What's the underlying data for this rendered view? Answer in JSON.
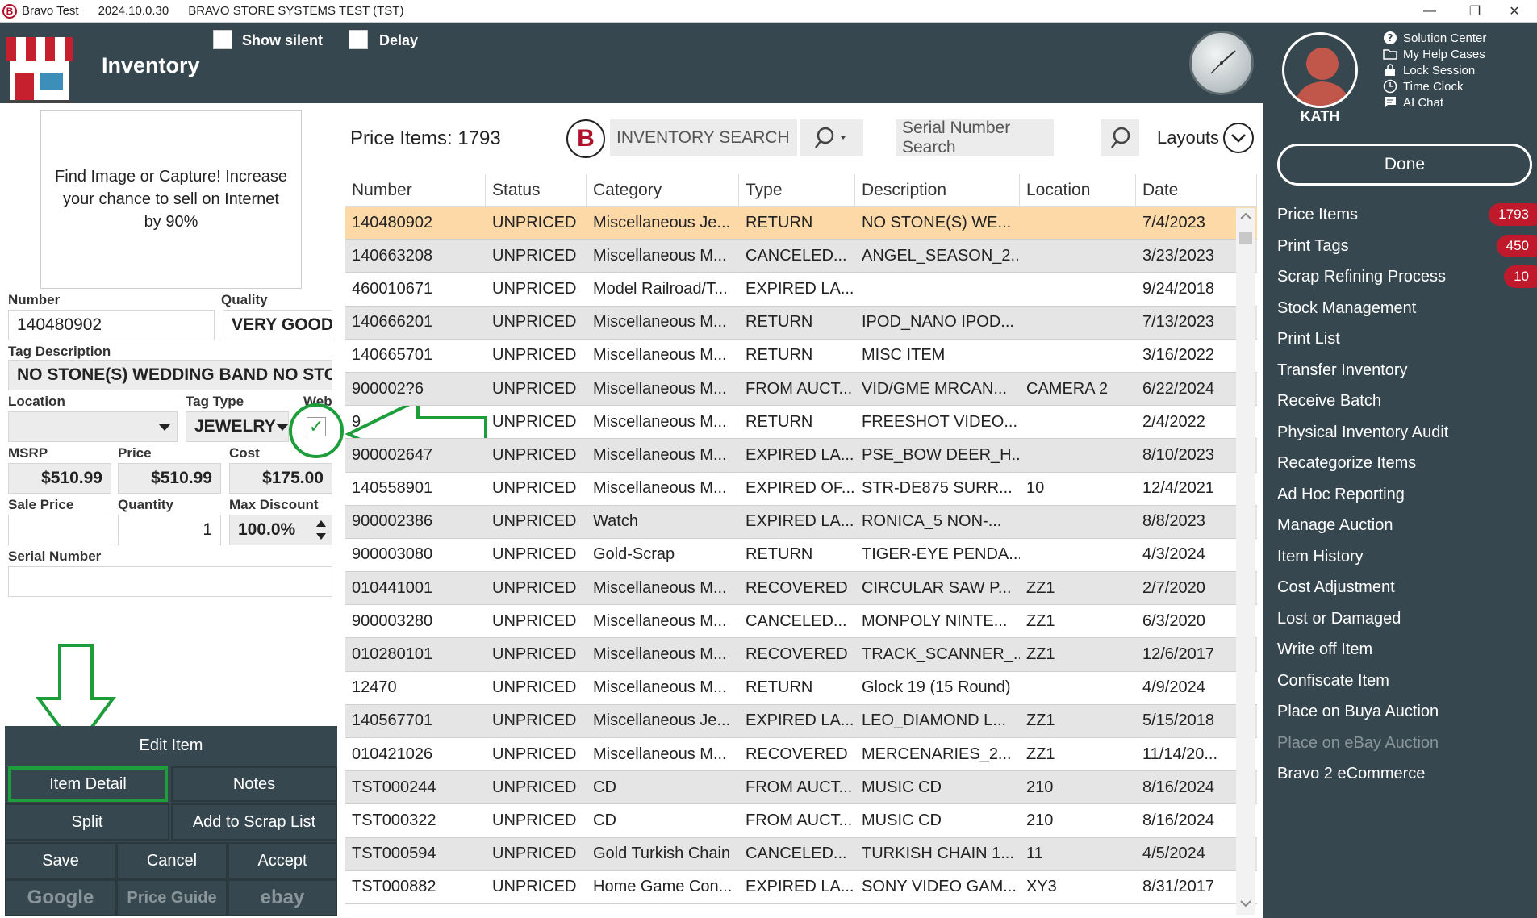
{
  "titlebar": {
    "app": "Bravo Test",
    "version": "2024.10.0.30",
    "system": "BRAVO STORE SYSTEMS TEST (TST)",
    "minimize": "—",
    "maximize": "❐",
    "close": "✕"
  },
  "header": {
    "title": "Inventory",
    "show_silent": "Show silent",
    "delay": "Delay"
  },
  "user": {
    "name": "KATH",
    "links": [
      "Solution Center",
      "My Help Cases",
      "Lock Session",
      "Time Clock",
      "AI Chat"
    ]
  },
  "done_label": "Done",
  "menu": [
    {
      "label": "Price Items",
      "badge": "1793"
    },
    {
      "label": "Print Tags",
      "badge": "450"
    },
    {
      "label": "Scrap Refining Process",
      "badge": "10"
    },
    {
      "label": "Stock Management"
    },
    {
      "label": "Print List"
    },
    {
      "label": "Transfer Inventory"
    },
    {
      "label": "Receive Batch"
    },
    {
      "label": "Physical Inventory Audit"
    },
    {
      "label": "Recategorize Items"
    },
    {
      "label": "Ad Hoc Reporting"
    },
    {
      "label": "Manage Auction"
    },
    {
      "label": "Item History"
    },
    {
      "label": "Cost Adjustment"
    },
    {
      "label": "Lost or Damaged"
    },
    {
      "label": "Write off Item"
    },
    {
      "label": "Confiscate Item"
    },
    {
      "label": "Place on Buya Auction"
    },
    {
      "label": "Place on eBay Auction",
      "disabled": true
    },
    {
      "label": "Bravo 2 eCommerce"
    }
  ],
  "image_box": "Find Image or Capture! Increase your chance to sell on Internet by 90%",
  "form": {
    "number_label": "Number",
    "number": "140480902",
    "quality_label": "Quality",
    "quality": "VERY GOOD",
    "tagdesc_label": "Tag Description",
    "tagdesc": "NO STONE(S)  WEDDING BAND NO STO",
    "location_label": "Location",
    "location": "",
    "tagtype_label": "Tag Type",
    "tagtype": "JEWELRY",
    "web_label": "Web",
    "web_check": "✓",
    "msrp_label": "MSRP",
    "msrp": "$510.99",
    "price_label": "Price",
    "price": "$510.99",
    "cost_label": "Cost",
    "cost": "$175.00",
    "saleprice_label": "Sale Price",
    "saleprice": "",
    "quantity_label": "Quantity",
    "quantity": "1",
    "maxdisc_label": "Max Discount",
    "maxdisc": "100.0%",
    "serial_label": "Serial Number",
    "serial": ""
  },
  "buttons": {
    "edit_item": "Edit Item",
    "item_detail": "Item Detail",
    "notes": "Notes",
    "split": "Split",
    "add_scrap": "Add to Scrap List",
    "save": "Save",
    "cancel": "Cancel",
    "accept": "Accept",
    "google": "Google",
    "price_guide": "Price Guide",
    "ebay": "ebay"
  },
  "main": {
    "count_label": "Price Items:  1793",
    "inventory_search_placeholder": "INVENTORY SEARCH",
    "serial_search_placeholder": "Serial Number Search",
    "layouts": "Layouts"
  },
  "table": {
    "headers": [
      "Number",
      "Status",
      "Category",
      "Type",
      "Description",
      "Location",
      "Date"
    ],
    "rows": [
      [
        "140480902",
        "UNPRICED",
        "Miscellaneous Je...",
        "RETURN",
        "NO STONE(S)  WE...",
        "",
        "7/4/2023"
      ],
      [
        "140663208",
        "UNPRICED",
        "Miscellaneous M...",
        "CANCELED...",
        "ANGEL_SEASON_2...",
        "",
        "3/23/2023"
      ],
      [
        "460010671",
        "UNPRICED",
        "Model Railroad/T...",
        "EXPIRED LA...",
        "",
        "",
        "9/24/2018"
      ],
      [
        "140666201",
        "UNPRICED",
        "Miscellaneous M...",
        "RETURN",
        "IPOD_NANO  IPOD...",
        "",
        "7/13/2023"
      ],
      [
        "140665701",
        "UNPRICED",
        "Miscellaneous M...",
        "RETURN",
        "MISC ITEM",
        "",
        "3/16/2022"
      ],
      [
        "900002?6",
        "UNPRICED",
        "Miscellaneous M...",
        "FROM AUCT...",
        "VID/GME MRCAN...",
        "CAMERA 2",
        "6/22/2024"
      ],
      [
        "9",
        "UNPRICED",
        "Miscellaneous M...",
        "RETURN",
        " FREESHOT VIDEO...",
        "",
        "2/4/2022"
      ],
      [
        "900002647",
        "UNPRICED",
        "Miscellaneous M...",
        "EXPIRED LA...",
        "PSE_BOW DEER_H...",
        "",
        "8/10/2023"
      ],
      [
        "140558901",
        "UNPRICED",
        "Miscellaneous M...",
        "EXPIRED OF...",
        " STR-DE875 SURR...",
        "10",
        "12/4/2021"
      ],
      [
        "900002386",
        "UNPRICED",
        "Watch",
        "EXPIRED LA...",
        "RONICA_5  NON-...",
        "",
        "8/8/2023"
      ],
      [
        "900003080",
        "UNPRICED",
        "Gold-Scrap",
        "RETURN",
        "TIGER-EYE  PENDA...",
        "",
        "4/3/2024"
      ],
      [
        "010441001",
        "UNPRICED",
        "Miscellaneous M...",
        "RECOVERED",
        "CIRCULAR SAW  P...",
        "ZZ1",
        "2/7/2020"
      ],
      [
        "900003280",
        "UNPRICED",
        "Miscellaneous M...",
        "CANCELED...",
        "MONPOLY NINTE...",
        "ZZ1",
        "6/3/2020"
      ],
      [
        "010280101",
        "UNPRICED",
        "Miscellaneous M...",
        "RECOVERED",
        "TRACK_SCANNER_...",
        "ZZ1",
        "12/6/2017"
      ],
      [
        "12470",
        "UNPRICED",
        "Miscellaneous M...",
        "RETURN",
        "Glock 19 (15 Round)",
        "",
        "4/9/2024"
      ],
      [
        "140567701",
        "UNPRICED",
        "Miscellaneous Je...",
        "EXPIRED LA...",
        "LEO_DIAMOND  L...",
        "ZZ1",
        "5/15/2018"
      ],
      [
        "010421026",
        "UNPRICED",
        "Miscellaneous M...",
        "RECOVERED",
        "MERCENARIES_2...",
        "ZZ1",
        "11/14/20..."
      ],
      [
        "TST000244",
        "UNPRICED",
        "CD",
        "FROM AUCT...",
        "MUSIC CD",
        "210",
        "8/16/2024"
      ],
      [
        "TST000322",
        "UNPRICED",
        "CD",
        "FROM AUCT...",
        "MUSIC CD",
        "210",
        "8/16/2024"
      ],
      [
        "TST000594",
        "UNPRICED",
        "Gold Turkish Chain",
        "CANCELED...",
        "TURKISH CHAIN 1...",
        "11",
        "4/5/2024"
      ],
      [
        "TST000882",
        "UNPRICED",
        "Home Game Con...",
        "EXPIRED LA...",
        "SONY VIDEO GAM...",
        "XY3",
        "8/31/2017"
      ]
    ]
  },
  "colors": {
    "header_bg": "#36474f",
    "selected_row": "#fdd9a7",
    "badge": "#c0192b",
    "annotation": "#1e9e3a"
  }
}
